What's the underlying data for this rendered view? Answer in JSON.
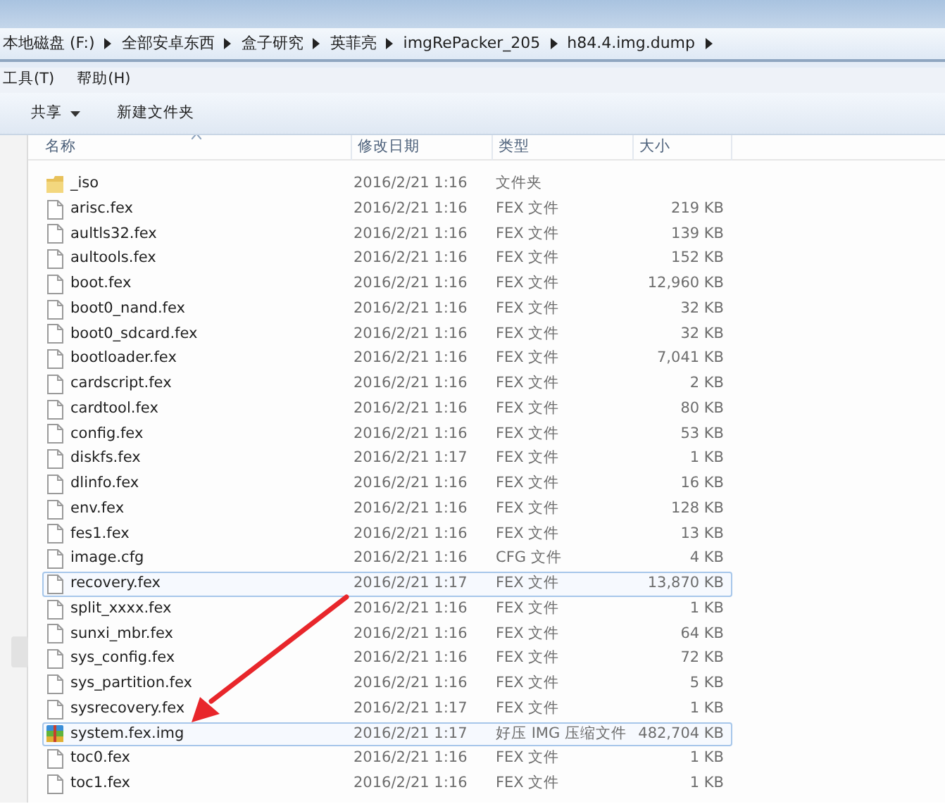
{
  "address_bar": {
    "segments": [
      "本地磁盘 (F:)",
      "全部安卓东西",
      "盒子研究",
      "英菲亮",
      "imgRePacker_205",
      "h84.4.img.dump"
    ]
  },
  "menu_bar": [
    "工具(T)",
    "帮助(H)"
  ],
  "toolbar": [
    {
      "label": "共享",
      "dropdown": true
    },
    {
      "label": "新建文件夹",
      "dropdown": false
    }
  ],
  "columns": [
    "名称",
    "修改日期",
    "类型",
    "大小"
  ],
  "files": [
    {
      "kind": "folder",
      "name": "_iso",
      "modified": "2016/2/21 1:16",
      "type": "文件夹",
      "selected": false
    },
    {
      "kind": "file",
      "name": "arisc.fex",
      "modified": "2016/2/21 1:16",
      "type": "FEX 文件",
      "size": "219 KB",
      "selected": false
    },
    {
      "kind": "file",
      "name": "aultls32.fex",
      "modified": "2016/2/21 1:16",
      "type": "FEX 文件",
      "size": "139 KB",
      "selected": false
    },
    {
      "kind": "file",
      "name": "aultools.fex",
      "modified": "2016/2/21 1:16",
      "type": "FEX 文件",
      "size": "152 KB",
      "selected": false
    },
    {
      "kind": "file",
      "name": "boot.fex",
      "modified": "2016/2/21 1:16",
      "type": "FEX 文件",
      "size": "12,960 KB",
      "selected": false
    },
    {
      "kind": "file",
      "name": "boot0_nand.fex",
      "modified": "2016/2/21 1:16",
      "type": "FEX 文件",
      "size": "32 KB",
      "selected": false
    },
    {
      "kind": "file",
      "name": "boot0_sdcard.fex",
      "modified": "2016/2/21 1:16",
      "type": "FEX 文件",
      "size": "32 KB",
      "selected": false
    },
    {
      "kind": "file",
      "name": "bootloader.fex",
      "modified": "2016/2/21 1:16",
      "type": "FEX 文件",
      "size": "7,041 KB",
      "selected": false
    },
    {
      "kind": "file",
      "name": "cardscript.fex",
      "modified": "2016/2/21 1:16",
      "type": "FEX 文件",
      "size": "2 KB",
      "selected": false
    },
    {
      "kind": "file",
      "name": "cardtool.fex",
      "modified": "2016/2/21 1:16",
      "type": "FEX 文件",
      "size": "80 KB",
      "selected": false
    },
    {
      "kind": "file",
      "name": "config.fex",
      "modified": "2016/2/21 1:16",
      "type": "FEX 文件",
      "size": "53 KB",
      "selected": false
    },
    {
      "kind": "file",
      "name": "diskfs.fex",
      "modified": "2016/2/21 1:17",
      "type": "FEX 文件",
      "size": "1 KB",
      "selected": false
    },
    {
      "kind": "file",
      "name": "dlinfo.fex",
      "modified": "2016/2/21 1:16",
      "type": "FEX 文件",
      "size": "16 KB",
      "selected": false
    },
    {
      "kind": "file",
      "name": "env.fex",
      "modified": "2016/2/21 1:16",
      "type": "FEX 文件",
      "size": "128 KB",
      "selected": false
    },
    {
      "kind": "file",
      "name": "fes1.fex",
      "modified": "2016/2/21 1:16",
      "type": "FEX 文件",
      "size": "13 KB",
      "selected": false
    },
    {
      "kind": "file",
      "name": "image.cfg",
      "modified": "2016/2/21 1:16",
      "type": "CFG 文件",
      "size": "4 KB",
      "selected": false
    },
    {
      "kind": "file",
      "name": "recovery.fex",
      "modified": "2016/2/21 1:17",
      "type": "FEX 文件",
      "size": "13,870 KB",
      "selected": true
    },
    {
      "kind": "file",
      "name": "split_xxxx.fex",
      "modified": "2016/2/21 1:16",
      "type": "FEX 文件",
      "size": "1 KB",
      "selected": false
    },
    {
      "kind": "file",
      "name": "sunxi_mbr.fex",
      "modified": "2016/2/21 1:16",
      "type": "FEX 文件",
      "size": "64 KB",
      "selected": false
    },
    {
      "kind": "file",
      "name": "sys_config.fex",
      "modified": "2016/2/21 1:16",
      "type": "FEX 文件",
      "size": "72 KB",
      "selected": false
    },
    {
      "kind": "file",
      "name": "sys_partition.fex",
      "modified": "2016/2/21 1:16",
      "type": "FEX 文件",
      "size": "5 KB",
      "selected": false
    },
    {
      "kind": "file",
      "name": "sysrecovery.fex",
      "modified": "2016/2/21 1:17",
      "type": "FEX 文件",
      "size": "1 KB",
      "selected": false
    },
    {
      "kind": "archive",
      "name": "system.fex.img",
      "modified": "2016/2/21 1:17",
      "type": "好压 IMG 压缩文件",
      "size": "482,704 KB",
      "selected": true
    },
    {
      "kind": "file",
      "name": "toc0.fex",
      "modified": "2016/2/21 1:16",
      "type": "FEX 文件",
      "size": "1 KB",
      "selected": false
    },
    {
      "kind": "file",
      "name": "toc1.fex",
      "modified": "2016/2/21 1:16",
      "type": "FEX 文件",
      "size": "1 KB",
      "selected": false
    }
  ]
}
